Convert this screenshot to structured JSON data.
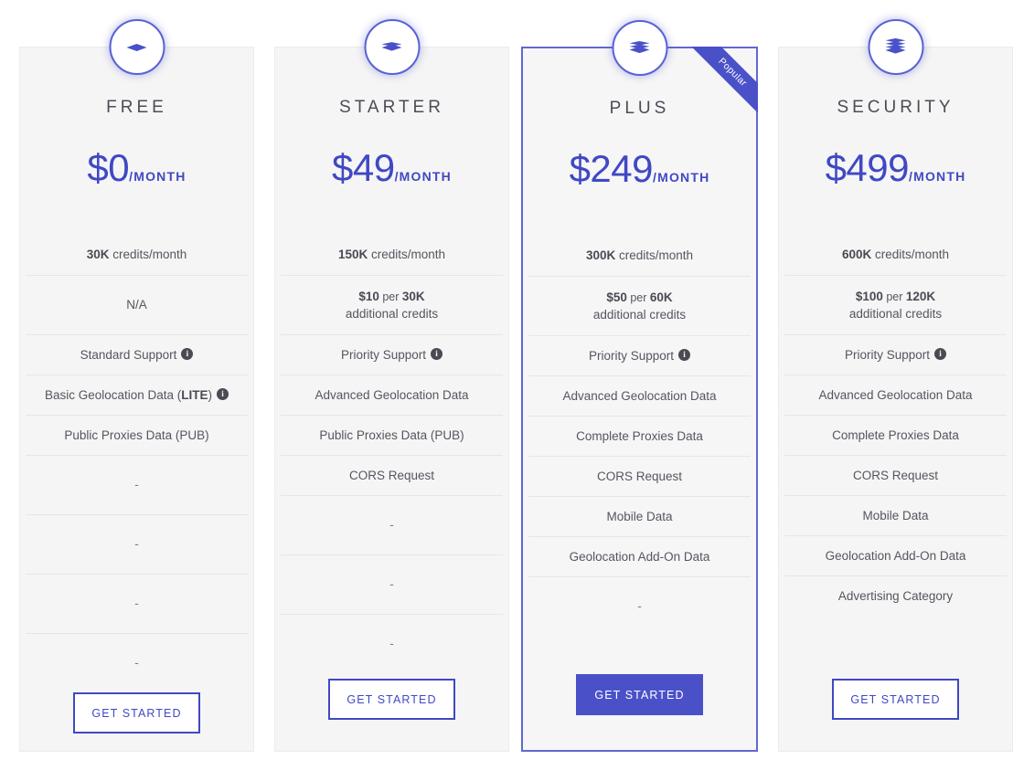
{
  "accent_color": "#4048c4",
  "featured_border_color": "#6168d0",
  "card_bg": "#f5f5f5",
  "info_icon_color": "#4a4a52",
  "ribbon": {
    "label": "Popular"
  },
  "plans": [
    {
      "id": "free",
      "title": "FREE",
      "icon": "layers-1-icon",
      "icon_layers": 1,
      "price_amount": "$0",
      "price_period": "/MONTH",
      "featured": false,
      "cta_label": "GET STARTED",
      "cta_style": "outline",
      "features": [
        {
          "type": "credits",
          "bold": "30K",
          "rest": " credits/month"
        },
        {
          "type": "text",
          "text": "N/A",
          "tall": true
        },
        {
          "type": "info",
          "text": "Standard Support",
          "info": true
        },
        {
          "type": "info_bold",
          "pre": "Basic Geolocation Data (",
          "bold": "LITE",
          "post": ")",
          "info": true
        },
        {
          "type": "text",
          "text": "Public Proxies Data (PUB)"
        },
        {
          "type": "dash",
          "text": "-",
          "tall": true
        },
        {
          "type": "dash",
          "text": "-",
          "tall": true
        },
        {
          "type": "dash",
          "text": "-",
          "tall": true
        },
        {
          "type": "dash",
          "text": "-",
          "tall": true
        }
      ]
    },
    {
      "id": "starter",
      "title": "STARTER",
      "icon": "layers-2-icon",
      "icon_layers": 2,
      "price_amount": "$49",
      "price_period": "/MONTH",
      "featured": false,
      "cta_label": "GET STARTED",
      "cta_style": "outline",
      "features": [
        {
          "type": "credits",
          "bold": "150K",
          "rest": " credits/month"
        },
        {
          "type": "addon",
          "price": "$10",
          "per": " per ",
          "unit": "30K",
          "line2": "additional credits",
          "tall": true
        },
        {
          "type": "info",
          "text": "Priority Support",
          "info": true
        },
        {
          "type": "text",
          "text": "Advanced Geolocation Data"
        },
        {
          "type": "text",
          "text": "Public Proxies Data (PUB)"
        },
        {
          "type": "text",
          "text": "CORS Request"
        },
        {
          "type": "dash",
          "text": "-",
          "tall": true
        },
        {
          "type": "dash",
          "text": "-",
          "tall": true
        },
        {
          "type": "dash",
          "text": "-",
          "tall": true
        }
      ]
    },
    {
      "id": "plus",
      "title": "PLUS",
      "icon": "layers-3-icon",
      "icon_layers": 3,
      "price_amount": "$249",
      "price_period": "/MONTH",
      "featured": true,
      "badge": "Popular",
      "cta_label": "GET STARTED",
      "cta_style": "solid",
      "features": [
        {
          "type": "credits",
          "bold": "300K",
          "rest": " credits/month"
        },
        {
          "type": "addon",
          "price": "$50",
          "per": " per ",
          "unit": "60K",
          "line2": "additional credits",
          "tall": true
        },
        {
          "type": "info",
          "text": "Priority Support",
          "info": true
        },
        {
          "type": "text",
          "text": "Advanced Geolocation Data"
        },
        {
          "type": "text",
          "text": "Complete Proxies Data"
        },
        {
          "type": "text",
          "text": "CORS Request"
        },
        {
          "type": "text",
          "text": "Mobile Data"
        },
        {
          "type": "text",
          "text": "Geolocation Add-On Data"
        },
        {
          "type": "dash",
          "text": "-",
          "tall": true
        }
      ]
    },
    {
      "id": "security",
      "title": "SECURITY",
      "icon": "layers-4-icon",
      "icon_layers": 4,
      "price_amount": "$499",
      "price_period": "/MONTH",
      "featured": false,
      "cta_label": "GET STARTED",
      "cta_style": "outline",
      "features": [
        {
          "type": "credits",
          "bold": "600K",
          "rest": " credits/month"
        },
        {
          "type": "addon",
          "price": "$100",
          "per": " per ",
          "unit": "120K",
          "line2": "additional credits",
          "tall": true
        },
        {
          "type": "info",
          "text": "Priority Support",
          "info": true
        },
        {
          "type": "text",
          "text": "Advanced Geolocation Data"
        },
        {
          "type": "text",
          "text": "Complete Proxies Data"
        },
        {
          "type": "text",
          "text": "CORS Request"
        },
        {
          "type": "text",
          "text": "Mobile Data"
        },
        {
          "type": "text",
          "text": "Geolocation Add-On Data"
        },
        {
          "type": "text",
          "text": "Advertising Category"
        }
      ]
    }
  ]
}
